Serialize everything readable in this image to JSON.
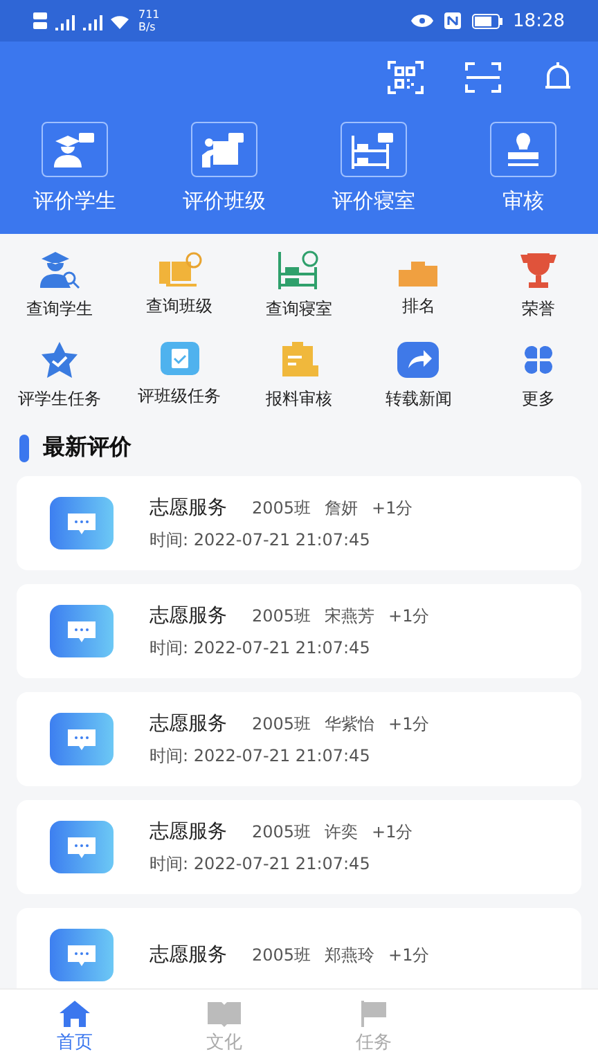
{
  "status_bar": {
    "speed": "711",
    "speed_unit": "B/s",
    "time": "18:28"
  },
  "header_actions": [
    {
      "kind": "qr"
    },
    {
      "kind": "scan"
    },
    {
      "kind": "bell"
    }
  ],
  "header_items": [
    {
      "label": "评价学生",
      "kind": "student"
    },
    {
      "label": "评价班级",
      "kind": "class"
    },
    {
      "label": "评价寝室",
      "kind": "dorm"
    },
    {
      "label": "审核",
      "kind": "stamp"
    }
  ],
  "shortcuts": [
    {
      "label": "查询学生",
      "kind": "student"
    },
    {
      "label": "查询班级",
      "kind": "class"
    },
    {
      "label": "查询寝室",
      "kind": "dorm"
    },
    {
      "label": "排名",
      "kind": "podium"
    },
    {
      "label": "荣誉",
      "kind": "trophy"
    },
    {
      "label": "评学生任务",
      "kind": "star"
    },
    {
      "label": "评班级任务",
      "kind": "task"
    },
    {
      "label": "报料审核",
      "kind": "clipboard"
    },
    {
      "label": "转载新闻",
      "kind": "share"
    },
    {
      "label": "更多",
      "kind": "more"
    }
  ],
  "section_title": "最新评价",
  "evaluations": [
    {
      "title": "志愿服务",
      "class": "2005班",
      "name": "詹妍",
      "points": "+1分",
      "time_label": "时间:",
      "time": "2022-07-21 21:07:45"
    },
    {
      "title": "志愿服务",
      "class": "2005班",
      "name": "宋燕芳",
      "points": "+1分",
      "time_label": "时间:",
      "time": "2022-07-21 21:07:45"
    },
    {
      "title": "志愿服务",
      "class": "2005班",
      "name": "华紫怡",
      "points": "+1分",
      "time_label": "时间:",
      "time": "2022-07-21 21:07:45"
    },
    {
      "title": "志愿服务",
      "class": "2005班",
      "name": "许奕",
      "points": "+1分",
      "time_label": "时间:",
      "time": "2022-07-21 21:07:45"
    },
    {
      "title": "志愿服务",
      "class": "2005班",
      "name": "郑燕玲",
      "points": "+1分"
    }
  ],
  "tabs": [
    {
      "label": "首页",
      "kind": "home",
      "selected": true
    },
    {
      "label": "文化",
      "kind": "book",
      "selected": false
    },
    {
      "label": "任务",
      "kind": "flag",
      "selected": false
    }
  ]
}
